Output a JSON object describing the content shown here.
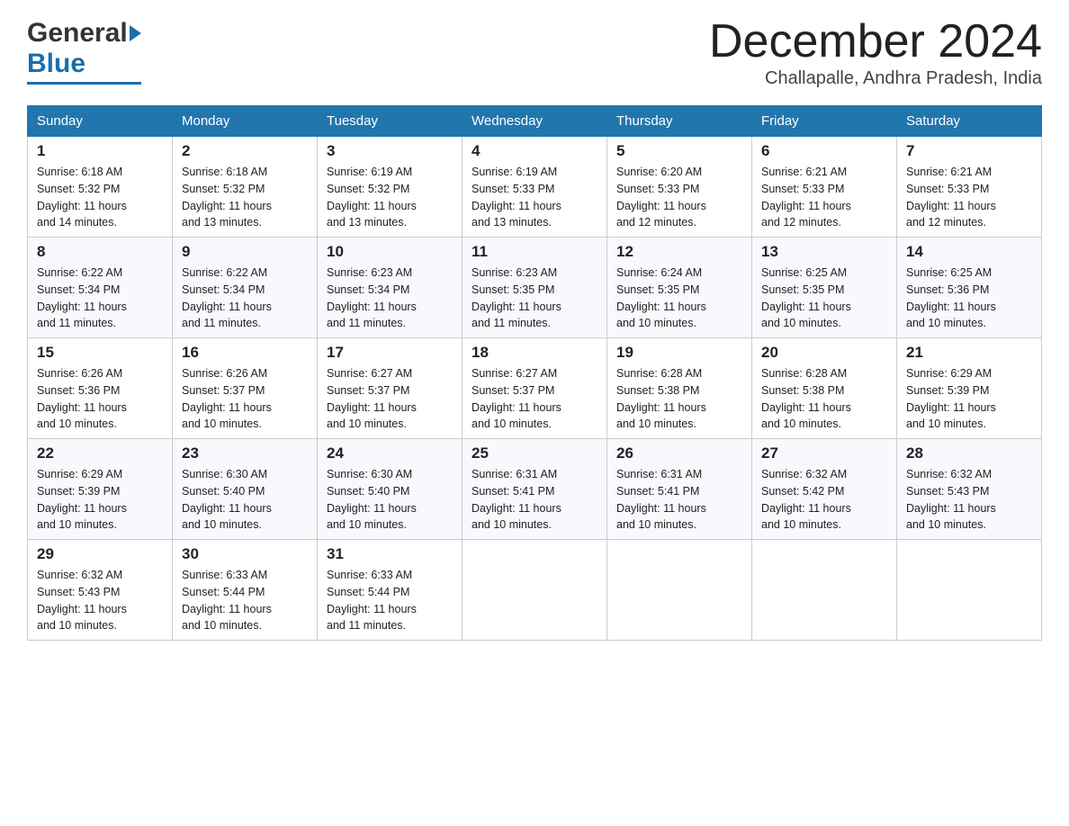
{
  "header": {
    "logo_general": "General",
    "logo_blue": "Blue",
    "month_title": "December 2024",
    "location": "Challapalle, Andhra Pradesh, India"
  },
  "days_of_week": [
    "Sunday",
    "Monday",
    "Tuesday",
    "Wednesday",
    "Thursday",
    "Friday",
    "Saturday"
  ],
  "weeks": [
    [
      {
        "day": "1",
        "sunrise": "6:18 AM",
        "sunset": "5:32 PM",
        "daylight": "11 hours and 14 minutes."
      },
      {
        "day": "2",
        "sunrise": "6:18 AM",
        "sunset": "5:32 PM",
        "daylight": "11 hours and 13 minutes."
      },
      {
        "day": "3",
        "sunrise": "6:19 AM",
        "sunset": "5:32 PM",
        "daylight": "11 hours and 13 minutes."
      },
      {
        "day": "4",
        "sunrise": "6:19 AM",
        "sunset": "5:33 PM",
        "daylight": "11 hours and 13 minutes."
      },
      {
        "day": "5",
        "sunrise": "6:20 AM",
        "sunset": "5:33 PM",
        "daylight": "11 hours and 12 minutes."
      },
      {
        "day": "6",
        "sunrise": "6:21 AM",
        "sunset": "5:33 PM",
        "daylight": "11 hours and 12 minutes."
      },
      {
        "day": "7",
        "sunrise": "6:21 AM",
        "sunset": "5:33 PM",
        "daylight": "11 hours and 12 minutes."
      }
    ],
    [
      {
        "day": "8",
        "sunrise": "6:22 AM",
        "sunset": "5:34 PM",
        "daylight": "11 hours and 11 minutes."
      },
      {
        "day": "9",
        "sunrise": "6:22 AM",
        "sunset": "5:34 PM",
        "daylight": "11 hours and 11 minutes."
      },
      {
        "day": "10",
        "sunrise": "6:23 AM",
        "sunset": "5:34 PM",
        "daylight": "11 hours and 11 minutes."
      },
      {
        "day": "11",
        "sunrise": "6:23 AM",
        "sunset": "5:35 PM",
        "daylight": "11 hours and 11 minutes."
      },
      {
        "day": "12",
        "sunrise": "6:24 AM",
        "sunset": "5:35 PM",
        "daylight": "11 hours and 10 minutes."
      },
      {
        "day": "13",
        "sunrise": "6:25 AM",
        "sunset": "5:35 PM",
        "daylight": "11 hours and 10 minutes."
      },
      {
        "day": "14",
        "sunrise": "6:25 AM",
        "sunset": "5:36 PM",
        "daylight": "11 hours and 10 minutes."
      }
    ],
    [
      {
        "day": "15",
        "sunrise": "6:26 AM",
        "sunset": "5:36 PM",
        "daylight": "11 hours and 10 minutes."
      },
      {
        "day": "16",
        "sunrise": "6:26 AM",
        "sunset": "5:37 PM",
        "daylight": "11 hours and 10 minutes."
      },
      {
        "day": "17",
        "sunrise": "6:27 AM",
        "sunset": "5:37 PM",
        "daylight": "11 hours and 10 minutes."
      },
      {
        "day": "18",
        "sunrise": "6:27 AM",
        "sunset": "5:37 PM",
        "daylight": "11 hours and 10 minutes."
      },
      {
        "day": "19",
        "sunrise": "6:28 AM",
        "sunset": "5:38 PM",
        "daylight": "11 hours and 10 minutes."
      },
      {
        "day": "20",
        "sunrise": "6:28 AM",
        "sunset": "5:38 PM",
        "daylight": "11 hours and 10 minutes."
      },
      {
        "day": "21",
        "sunrise": "6:29 AM",
        "sunset": "5:39 PM",
        "daylight": "11 hours and 10 minutes."
      }
    ],
    [
      {
        "day": "22",
        "sunrise": "6:29 AM",
        "sunset": "5:39 PM",
        "daylight": "11 hours and 10 minutes."
      },
      {
        "day": "23",
        "sunrise": "6:30 AM",
        "sunset": "5:40 PM",
        "daylight": "11 hours and 10 minutes."
      },
      {
        "day": "24",
        "sunrise": "6:30 AM",
        "sunset": "5:40 PM",
        "daylight": "11 hours and 10 minutes."
      },
      {
        "day": "25",
        "sunrise": "6:31 AM",
        "sunset": "5:41 PM",
        "daylight": "11 hours and 10 minutes."
      },
      {
        "day": "26",
        "sunrise": "6:31 AM",
        "sunset": "5:41 PM",
        "daylight": "11 hours and 10 minutes."
      },
      {
        "day": "27",
        "sunrise": "6:32 AM",
        "sunset": "5:42 PM",
        "daylight": "11 hours and 10 minutes."
      },
      {
        "day": "28",
        "sunrise": "6:32 AM",
        "sunset": "5:43 PM",
        "daylight": "11 hours and 10 minutes."
      }
    ],
    [
      {
        "day": "29",
        "sunrise": "6:32 AM",
        "sunset": "5:43 PM",
        "daylight": "11 hours and 10 minutes."
      },
      {
        "day": "30",
        "sunrise": "6:33 AM",
        "sunset": "5:44 PM",
        "daylight": "11 hours and 10 minutes."
      },
      {
        "day": "31",
        "sunrise": "6:33 AM",
        "sunset": "5:44 PM",
        "daylight": "11 hours and 11 minutes."
      },
      null,
      null,
      null,
      null
    ]
  ],
  "labels": {
    "sunrise": "Sunrise:",
    "sunset": "Sunset:",
    "daylight": "Daylight:"
  }
}
